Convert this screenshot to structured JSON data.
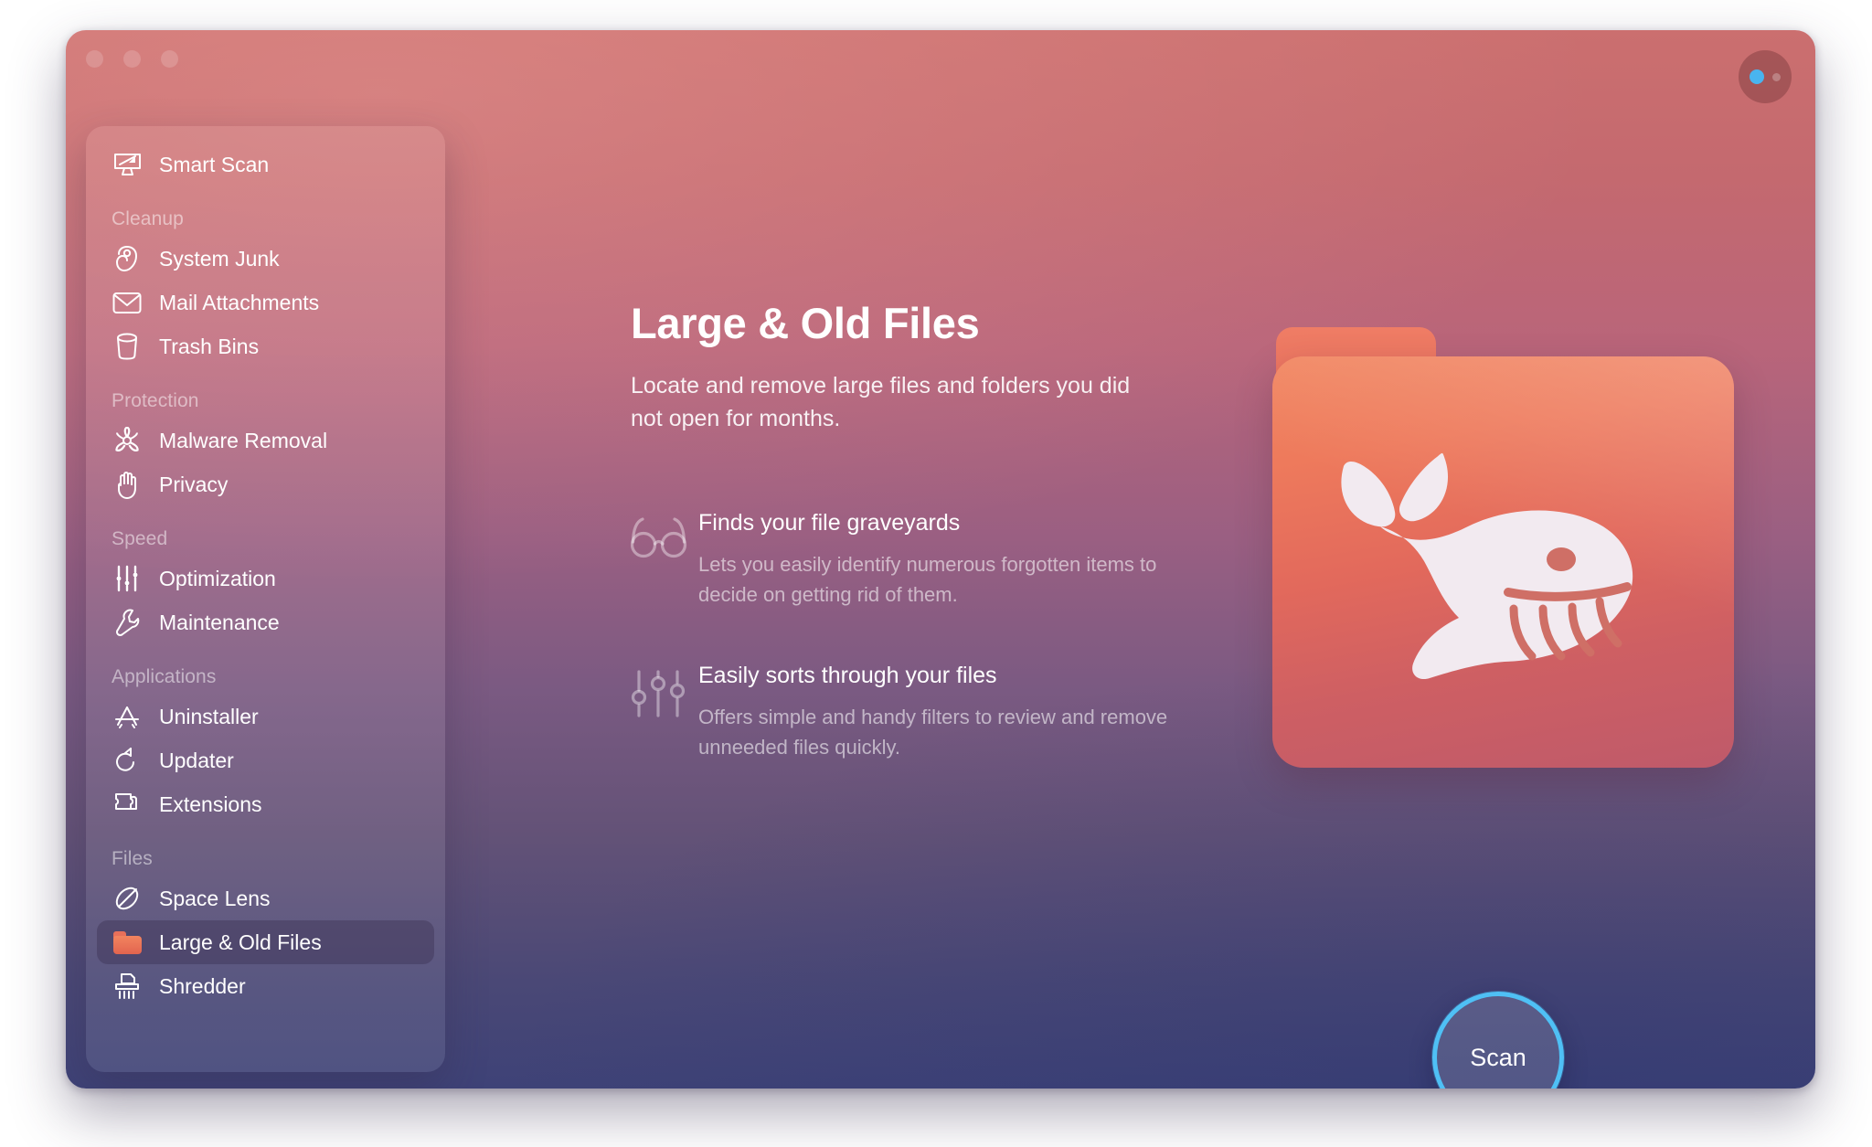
{
  "window": {
    "traffic_lights": [
      "close",
      "minimize",
      "zoom"
    ],
    "status_orb": {
      "primary_dot_color": "#49b4ef",
      "secondary_dot_color": "#b9a7ab"
    }
  },
  "sidebar": {
    "top_item": {
      "label": "Smart Scan",
      "icon": "smart-scan-icon"
    },
    "sections": [
      {
        "title": "Cleanup",
        "items": [
          {
            "label": "System Junk",
            "icon": "system-junk-icon",
            "selected": false
          },
          {
            "label": "Mail Attachments",
            "icon": "mail-icon",
            "selected": false
          },
          {
            "label": "Trash Bins",
            "icon": "trash-bin-icon",
            "selected": false
          }
        ]
      },
      {
        "title": "Protection",
        "items": [
          {
            "label": "Malware Removal",
            "icon": "biohazard-icon",
            "selected": false
          },
          {
            "label": "Privacy",
            "icon": "hand-icon",
            "selected": false
          }
        ]
      },
      {
        "title": "Speed",
        "items": [
          {
            "label": "Optimization",
            "icon": "sliders-icon",
            "selected": false
          },
          {
            "label": "Maintenance",
            "icon": "wrench-icon",
            "selected": false
          }
        ]
      },
      {
        "title": "Applications",
        "items": [
          {
            "label": "Uninstaller",
            "icon": "app-store-icon",
            "selected": false
          },
          {
            "label": "Updater",
            "icon": "update-arrow-icon",
            "selected": false
          },
          {
            "label": "Extensions",
            "icon": "puzzle-piece-icon",
            "selected": false
          }
        ]
      },
      {
        "title": "Files",
        "items": [
          {
            "label": "Space Lens",
            "icon": "space-lens-icon",
            "selected": false
          },
          {
            "label": "Large & Old Files",
            "icon": "orange-folder-icon",
            "selected": true
          },
          {
            "label": "Shredder",
            "icon": "shredder-icon",
            "selected": false
          }
        ]
      }
    ]
  },
  "main": {
    "title": "Large & Old Files",
    "subtitle": "Locate and remove large files and folders you did not open for months.",
    "features": [
      {
        "icon": "eyeglasses-icon",
        "heading": "Finds your file graveyards",
        "body": "Lets you easily identify numerous forgotten items to decide on getting rid of them."
      },
      {
        "icon": "filter-sliders-icon",
        "heading": "Easily sorts through your files",
        "body": "Offers simple and handy filters to review and remove unneeded files quickly."
      }
    ],
    "illustration": {
      "icon": "whale-folder-illustration"
    },
    "scan_button": {
      "label": "Scan",
      "ring_color": "#4fc0f5"
    }
  },
  "theme": {
    "gradient_top": "#cb6f6f",
    "gradient_bottom": "#3e4277",
    "accent_blue": "#4fc0f5",
    "folder_orange": "#f1855f"
  }
}
